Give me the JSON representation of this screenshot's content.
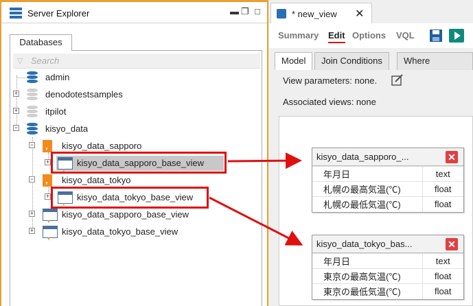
{
  "server_explorer": {
    "title": "Server Explorer",
    "tab": "Databases",
    "search_placeholder": "Search",
    "tree": [
      {
        "label": "admin"
      },
      {
        "label": "denodotestsamples"
      },
      {
        "label": "itpilot"
      },
      {
        "label": "kisyo_data"
      },
      {
        "label": "kisyo_data_sapporo"
      },
      {
        "label": "kisyo_data_sapporo_base_view"
      },
      {
        "label": "kisyo_data_tokyo"
      },
      {
        "label": "kisyo_data_tokyo_base_view"
      },
      {
        "label": "kisyo_data_sapporo_base_view"
      },
      {
        "label": "kisyo_data_tokyo_base_view"
      }
    ]
  },
  "editor": {
    "tab_title": "* new_view",
    "subtabs": [
      "Summary",
      "Edit",
      "Options",
      "VQL"
    ],
    "inner_tabs": [
      "Model",
      "Join Conditions",
      "Where Condition"
    ],
    "view_parameters": "View parameters: none.",
    "associated_views": "Associated views: none",
    "views": [
      {
        "title": "kisyo_data_sapporo_...",
        "rows": [
          {
            "name": "年月日",
            "type": "text"
          },
          {
            "name": "札幌の最高気温(℃)",
            "type": "float"
          },
          {
            "name": "札幌の最低気温(℃)",
            "type": "float"
          }
        ]
      },
      {
        "title": "kisyo_data_tokyo_bas...",
        "rows": [
          {
            "name": "年月日",
            "type": "text"
          },
          {
            "name": "東京の最高気温(℃)",
            "type": "float"
          },
          {
            "name": "東京の最低気温(℃)",
            "type": "float"
          }
        ]
      }
    ]
  },
  "colors": {
    "accent_orange": "#e8a030",
    "highlight_red": "#e01010"
  }
}
